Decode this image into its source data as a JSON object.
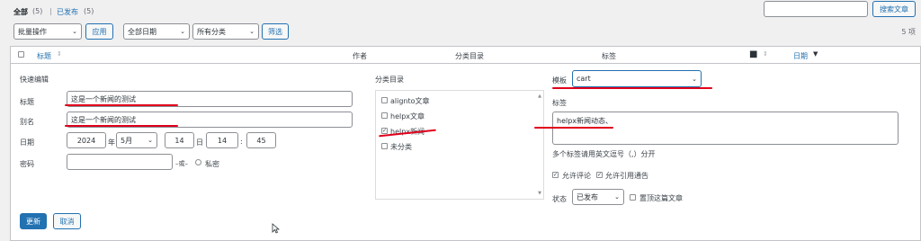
{
  "subsubsub": {
    "all": "全部",
    "all_count": "(5)",
    "sep": "|",
    "published": "已发布",
    "published_count": "(5)"
  },
  "search": {
    "button": "搜索文章",
    "value": ""
  },
  "tablenav": {
    "bulk_select": "批量操作",
    "apply": "应用",
    "date_select": "全部日期",
    "cat_select": "所有分类",
    "filter": "筛选",
    "items_count": "5 项"
  },
  "columns": {
    "title": "标题",
    "author": "作者",
    "categories": "分类目录",
    "tags": "标签",
    "date": "日期"
  },
  "quick_edit": {
    "heading": "快速编辑",
    "title_label": "标题",
    "title_value": "这是一个新闻的测试",
    "slug_label": "别名",
    "slug_value": "这是一个新闻的测试",
    "date_label": "日期",
    "year": "2024",
    "year_unit": "年",
    "month": "5月",
    "day": "14",
    "day_unit": "日",
    "hour": "14",
    "colon": ":",
    "minute": "45",
    "password_label": "密码",
    "password_value": "",
    "or_text": "–或–",
    "private_label": "私密",
    "categories_heading": "分类目录",
    "categories": [
      {
        "label": "alignto文章",
        "checked": false
      },
      {
        "label": "helpx文章",
        "checked": false
      },
      {
        "label": "helpx新闻",
        "checked": true
      },
      {
        "label": "未分类",
        "checked": false
      }
    ],
    "template_label": "模板",
    "template_value": "cart",
    "tags_label": "标签",
    "tags_value": "helpx新闻动态、",
    "tags_hint": "多个标签请用英文逗号（,）分开",
    "allow_comments": "允许评论",
    "allow_pings": "允许引用通告",
    "status_label": "状态",
    "status_value": "已发布",
    "sticky_label": "置顶这篇文章",
    "update_button": "更新",
    "cancel_button": "取消"
  }
}
